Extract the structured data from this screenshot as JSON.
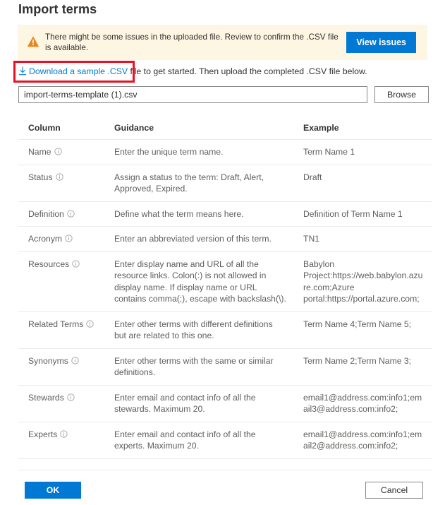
{
  "page_title": "Import terms",
  "banner": {
    "icon": "warning-triangle-icon",
    "message": "There might be some issues in the uploaded file. Review to confirm the .CSV file is available.",
    "action_label": "View issues",
    "background_color": "#fdf6e3",
    "icon_color": "#e8861a",
    "button_color": "#0078d4"
  },
  "download": {
    "icon": "download-arrow-icon",
    "link_text": "Download a sample .CSV",
    "rest_text": " file to get started. Then upload the completed .CSV file below.",
    "link_color": "#0078d4",
    "highlight_color": "#e81123"
  },
  "file_picker": {
    "value": "import-terms-template (1).csv",
    "placeholder": "",
    "browse_label": "Browse"
  },
  "table": {
    "headers": {
      "column": "Column",
      "guidance": "Guidance",
      "example": "Example"
    },
    "info_icon": "info-circle-icon",
    "rows": [
      {
        "column": "Name",
        "guidance": "Enter the unique term name.",
        "example": "Term Name 1"
      },
      {
        "column": "Status",
        "guidance": "Assign a status to the term: Draft, Alert, Approved, Expired.",
        "example": "Draft"
      },
      {
        "column": "Definition",
        "guidance": "Define what the term means here.",
        "example": "Definition of Term Name 1"
      },
      {
        "column": "Acronym",
        "guidance": "Enter an abbreviated version of this term.",
        "example": "TN1"
      },
      {
        "column": "Resources",
        "guidance": "Enter display name and URL of all the resource links. Colon(:) is not allowed in display name. If display name or URL contains comma(;), escape with backslash(\\).",
        "example": "Babylon Project:https://web.babylon.azure.com;Azure portal:https://portal.azure.com;"
      },
      {
        "column": "Related Terms",
        "guidance": "Enter other terms with different definitions but are related to this one.",
        "example": "Term Name 4;Term Name 5;"
      },
      {
        "column": "Synonyms",
        "guidance": "Enter other terms with the same or similar definitions.",
        "example": "Term Name 2;Term Name 3;"
      },
      {
        "column": "Stewards",
        "guidance": "Enter email and contact info of all the stewards. Maximum 20.",
        "example": "email1@address.com:info1;email3@address.com:info2;"
      },
      {
        "column": "Experts",
        "guidance": "Enter email and contact info of all the experts. Maximum 20.",
        "example": "email1@address.com:info1;email2@address.com:info2;"
      }
    ]
  },
  "footer": {
    "ok_label": "OK",
    "cancel_label": "Cancel"
  }
}
